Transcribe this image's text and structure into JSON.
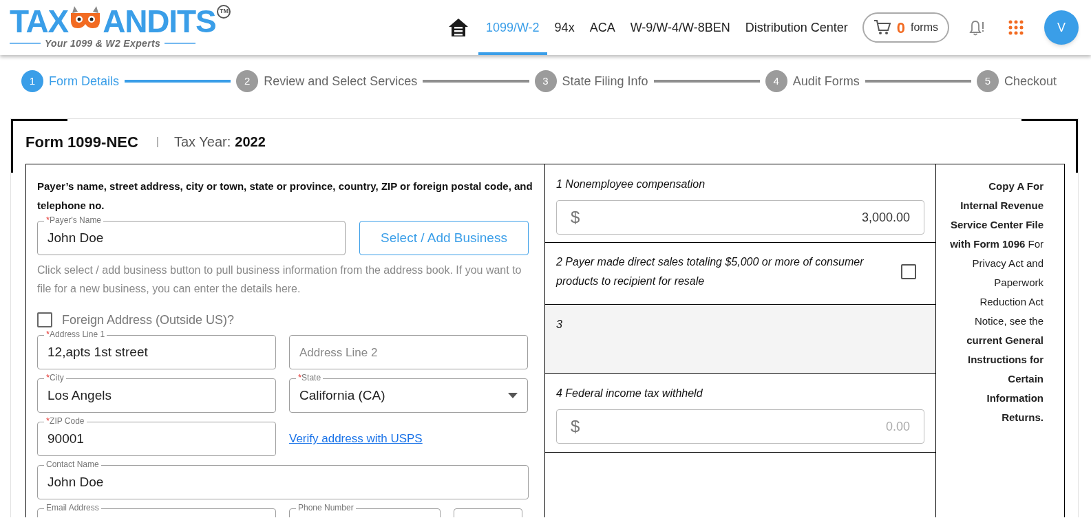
{
  "logo": {
    "left": "TAX",
    "right": "ANDITS",
    "trademark": "TM",
    "tagline": "Your 1099 & W2 Experts"
  },
  "nav": {
    "items": [
      {
        "label": "1099/W-2",
        "selected": true
      },
      {
        "label": "94x",
        "selected": false
      },
      {
        "label": "ACA",
        "selected": false
      },
      {
        "label": "W-9/W-4/W-8BEN",
        "selected": false
      },
      {
        "label": "Distribution Center",
        "selected": false
      }
    ],
    "cart": {
      "count": "0",
      "label": "forms"
    },
    "avatar": "V"
  },
  "steps": [
    {
      "number": "1",
      "label": "Form Details",
      "selected": true
    },
    {
      "number": "2",
      "label": "Review and Select Services",
      "selected": false
    },
    {
      "number": "3",
      "label": "State Filing Info",
      "selected": false
    },
    {
      "number": "4",
      "label": "Audit Forms",
      "selected": false
    },
    {
      "number": "5",
      "label": "Checkout",
      "selected": false
    }
  ],
  "form": {
    "title": "Form 1099-NEC",
    "separator": "|",
    "year_label": "Tax Year:",
    "year": "2022"
  },
  "required_mark": "*",
  "payer": {
    "heading": "Payer’s name, street address, city or town, state or province, country, ZIP or foreign postal code, and telephone no.",
    "name_field": {
      "label": "Payer's Name",
      "required": true,
      "value": "John Doe"
    },
    "button": "Select / Add Business",
    "help": "Click select / add business button to pull business information from the address book. If you want to file for a new business, you can enter the details here.",
    "foreign": {
      "label": "Foreign Address (Outside US)?",
      "checked": false
    },
    "rows": [
      [
        {
          "kind": "input",
          "label": "Address Line 1",
          "required": true,
          "value": "12,apts 1st street"
        },
        {
          "kind": "input",
          "placeholder": "Address Line 2"
        }
      ],
      [
        {
          "kind": "input",
          "label": "City",
          "required": true,
          "value": "Los Angels"
        },
        {
          "kind": "select",
          "label": "State",
          "required": true,
          "value": "California (CA)"
        }
      ],
      [
        {
          "kind": "input",
          "label": "ZIP Code",
          "required": true,
          "value": "90001"
        },
        {
          "kind": "link",
          "label": "Verify address with USPS"
        }
      ],
      [
        {
          "kind": "input",
          "label": "Contact Name",
          "value": "John Doe"
        }
      ],
      [
        {
          "kind": "input",
          "label": "Email Address"
        },
        {
          "kind": "input",
          "label": "Phone Number"
        },
        {
          "kind": "input"
        }
      ]
    ]
  },
  "boxes": [
    {
      "kind": "amount",
      "label": "1 Nonemployee compensation",
      "currency": "$",
      "value": "3,000.00"
    },
    {
      "kind": "checkbox",
      "label": "2 Payer made direct sales totaling $5,000 or more of consumer products to recipient for resale",
      "checked": false
    },
    {
      "kind": "disabled",
      "label": "3"
    },
    {
      "kind": "amount",
      "label": "4 Federal income tax withheld",
      "currency": "$",
      "placeholder": "0.00"
    }
  ],
  "copy_note": "**Copy A For Internal Revenue Service Center File with Form 1096** For Privacy Act and Paperwork Reduction Act Notice, see the **current General Instructions for Certain Information Returns.**"
}
